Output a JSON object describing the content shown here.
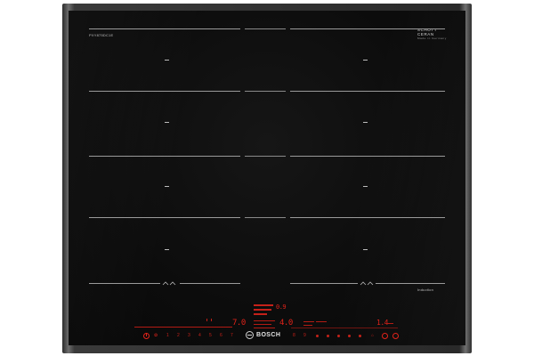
{
  "photo": {
    "subject": "Bosch induction cooktop",
    "brand": "BOSCH",
    "colors": {
      "glass": "#0c0c0c",
      "frame": "#6e6e6e",
      "zone_lines": "#9a9a9a",
      "display_red": "#e2231a",
      "background": "#ffffff"
    }
  },
  "top_label": "PXY875DC1E",
  "brand_block": {
    "line1": "SCHOTT",
    "line2": "CERAN",
    "line3": "Made in Germany"
  },
  "induction_label": "Induction",
  "display": {
    "left_level": "7.0",
    "center_level": "4.0",
    "timer": "1.4",
    "timer_unit": "min",
    "center_upper_value": "0.9"
  },
  "touch_scale": [
    "1",
    "2",
    "3",
    "4",
    "5",
    "6",
    "7",
    "8",
    "9"
  ],
  "icons": [
    "power-icon",
    "flex-zone-icon",
    "timer-icon",
    "favorite-icon",
    "bosch-logo-icon"
  ]
}
